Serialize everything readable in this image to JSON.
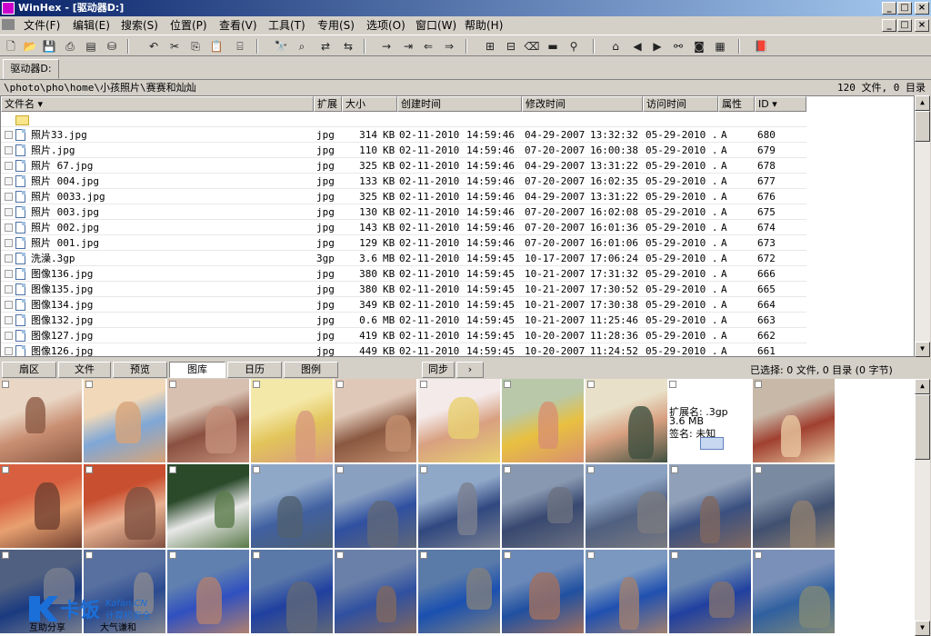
{
  "window": {
    "title": "WinHex - [驱动器D:]"
  },
  "menu": [
    "文件(F)",
    "编辑(E)",
    "搜索(S)",
    "位置(P)",
    "查看(V)",
    "工具(T)",
    "专用(S)",
    "选项(O)",
    "窗口(W)",
    "帮助(H)"
  ],
  "tab": {
    "label": "驱动器D:"
  },
  "path": {
    "text": "\\photo\\pho\\home\\小孩照片\\赛赛和灿灿",
    "count": "120 文件, 0 目录"
  },
  "columns": [
    "文件名",
    "扩展",
    "大小",
    "创建时间",
    "修改时间",
    "访问时间",
    "属性",
    "ID"
  ],
  "files": [
    {
      "name": "照片33.jpg",
      "ext": "jpg",
      "size": "314",
      "unit": "KB",
      "created": "02-11-2010",
      "ctime": "14:59:46",
      "modified": "04-29-2007",
      "mtime": "13:32:32",
      "accessed": "05-29-2010 ..",
      "attr": "A",
      "id": "680"
    },
    {
      "name": "照片.jpg",
      "ext": "jpg",
      "size": "110",
      "unit": "KB",
      "created": "02-11-2010",
      "ctime": "14:59:46",
      "modified": "07-20-2007",
      "mtime": "16:00:38",
      "accessed": "05-29-2010 ..",
      "attr": "A",
      "id": "679"
    },
    {
      "name": "照片 67.jpg",
      "ext": "jpg",
      "size": "325",
      "unit": "KB",
      "created": "02-11-2010",
      "ctime": "14:59:46",
      "modified": "04-29-2007",
      "mtime": "13:31:22",
      "accessed": "05-29-2010 ..",
      "attr": "A",
      "id": "678"
    },
    {
      "name": "照片 004.jpg",
      "ext": "jpg",
      "size": "133",
      "unit": "KB",
      "created": "02-11-2010",
      "ctime": "14:59:46",
      "modified": "07-20-2007",
      "mtime": "16:02:35",
      "accessed": "05-29-2010 ..",
      "attr": "A",
      "id": "677"
    },
    {
      "name": "照片 0033.jpg",
      "ext": "jpg",
      "size": "325",
      "unit": "KB",
      "created": "02-11-2010",
      "ctime": "14:59:46",
      "modified": "04-29-2007",
      "mtime": "13:31:22",
      "accessed": "05-29-2010 ..",
      "attr": "A",
      "id": "676"
    },
    {
      "name": "照片 003.jpg",
      "ext": "jpg",
      "size": "130",
      "unit": "KB",
      "created": "02-11-2010",
      "ctime": "14:59:46",
      "modified": "07-20-2007",
      "mtime": "16:02:08",
      "accessed": "05-29-2010 ..",
      "attr": "A",
      "id": "675"
    },
    {
      "name": "照片 002.jpg",
      "ext": "jpg",
      "size": "143",
      "unit": "KB",
      "created": "02-11-2010",
      "ctime": "14:59:46",
      "modified": "07-20-2007",
      "mtime": "16:01:36",
      "accessed": "05-29-2010 ..",
      "attr": "A",
      "id": "674"
    },
    {
      "name": "照片 001.jpg",
      "ext": "jpg",
      "size": "129",
      "unit": "KB",
      "created": "02-11-2010",
      "ctime": "14:59:46",
      "modified": "07-20-2007",
      "mtime": "16:01:06",
      "accessed": "05-29-2010 ..",
      "attr": "A",
      "id": "673"
    },
    {
      "name": "洗澡.3gp",
      "ext": "3gp",
      "size": "3.6",
      "unit": "MB",
      "created": "02-11-2010",
      "ctime": "14:59:45",
      "modified": "10-17-2007",
      "mtime": "17:06:24",
      "accessed": "05-29-2010 ..",
      "attr": "A",
      "id": "672"
    },
    {
      "name": "图像136.jpg",
      "ext": "jpg",
      "size": "380",
      "unit": "KB",
      "created": "02-11-2010",
      "ctime": "14:59:45",
      "modified": "10-21-2007",
      "mtime": "17:31:32",
      "accessed": "05-29-2010 ..",
      "attr": "A",
      "id": "666"
    },
    {
      "name": "图像135.jpg",
      "ext": "jpg",
      "size": "380",
      "unit": "KB",
      "created": "02-11-2010",
      "ctime": "14:59:45",
      "modified": "10-21-2007",
      "mtime": "17:30:52",
      "accessed": "05-29-2010 ..",
      "attr": "A",
      "id": "665"
    },
    {
      "name": "图像134.jpg",
      "ext": "jpg",
      "size": "349",
      "unit": "KB",
      "created": "02-11-2010",
      "ctime": "14:59:45",
      "modified": "10-21-2007",
      "mtime": "17:30:38",
      "accessed": "05-29-2010 ..",
      "attr": "A",
      "id": "664"
    },
    {
      "name": "图像132.jpg",
      "ext": "jpg",
      "size": "0.6",
      "unit": "MB",
      "created": "02-11-2010",
      "ctime": "14:59:45",
      "modified": "10-21-2007",
      "mtime": "11:25:46",
      "accessed": "05-29-2010 ..",
      "attr": "A",
      "id": "663"
    },
    {
      "name": "图像127.jpg",
      "ext": "jpg",
      "size": "419",
      "unit": "KB",
      "created": "02-11-2010",
      "ctime": "14:59:45",
      "modified": "10-20-2007",
      "mtime": "11:28:36",
      "accessed": "05-29-2010 ..",
      "attr": "A",
      "id": "662"
    },
    {
      "name": "图像126.jpg",
      "ext": "jpg",
      "size": "449",
      "unit": "KB",
      "created": "02-11-2010",
      "ctime": "14:59:45",
      "modified": "10-20-2007",
      "mtime": "11:24:52",
      "accessed": "05-29-2010 ..",
      "attr": "A",
      "id": "661"
    }
  ],
  "bottom_tabs": [
    "扇区",
    "文件",
    "预览",
    "图库",
    "日历",
    "图例"
  ],
  "sync": {
    "label": "同步",
    "arrow": "›"
  },
  "selection_status": "已选择: 0 文件, 0 目录 (0 字节)",
  "info_box": {
    "ext": "扩展名: .3gp",
    "size": "3.6 MB",
    "sign": "签名: 未知"
  },
  "watermark": {
    "brand": "卡饭",
    "en": "Kafan.CN",
    "cn": "计算机安全",
    "slogan1": "互助分享",
    "slogan2": "大气谦和"
  },
  "colors": {
    "title_start": "#0a246a",
    "title_end": "#a6caf0",
    "selected_tab": "#ffffff",
    "watermark_blue": "#1b6fd8"
  }
}
